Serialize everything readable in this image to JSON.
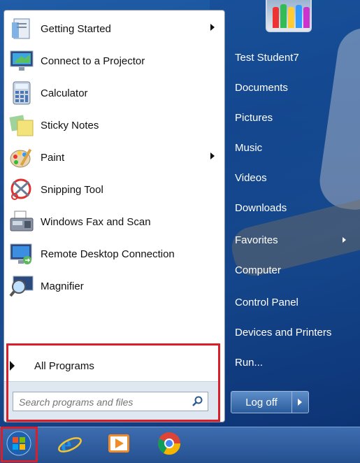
{
  "programs": [
    {
      "label": "Getting Started",
      "icon": "getting-started-icon",
      "has_submenu": true
    },
    {
      "label": "Connect to a Projector",
      "icon": "projector-icon",
      "has_submenu": false
    },
    {
      "label": "Calculator",
      "icon": "calculator-icon",
      "has_submenu": false
    },
    {
      "label": "Sticky Notes",
      "icon": "sticky-notes-icon",
      "has_submenu": false
    },
    {
      "label": "Paint",
      "icon": "paint-icon",
      "has_submenu": true
    },
    {
      "label": "Snipping Tool",
      "icon": "snipping-tool-icon",
      "has_submenu": false
    },
    {
      "label": "Windows Fax and Scan",
      "icon": "fax-scan-icon",
      "has_submenu": false
    },
    {
      "label": "Remote Desktop Connection",
      "icon": "remote-desktop-icon",
      "has_submenu": false
    },
    {
      "label": "Magnifier",
      "icon": "magnifier-icon",
      "has_submenu": false
    }
  ],
  "all_programs": "All Programs",
  "search": {
    "placeholder": "Search programs and files"
  },
  "right_pane": [
    {
      "label": "Test Student7",
      "has_submenu": false
    },
    {
      "label": "Documents",
      "has_submenu": false
    },
    {
      "label": "Pictures",
      "has_submenu": false
    },
    {
      "label": "Music",
      "has_submenu": false
    },
    {
      "label": "Videos",
      "has_submenu": false
    },
    {
      "label": "Downloads",
      "has_submenu": false
    },
    {
      "label": "Favorites",
      "has_submenu": true
    },
    {
      "label": "Computer",
      "has_submenu": false
    },
    {
      "label": "Control Panel",
      "has_submenu": false
    },
    {
      "label": "Devices and Printers",
      "has_submenu": false
    },
    {
      "label": "Run...",
      "has_submenu": false
    }
  ],
  "logoff": "Log off",
  "taskbar": [
    {
      "icon": "start-orb-icon"
    },
    {
      "icon": "internet-explorer-icon"
    },
    {
      "icon": "media-player-icon"
    },
    {
      "icon": "chrome-icon"
    }
  ],
  "colors": {
    "highlight": "#d81f2a",
    "taskbar": "#2d5a9a"
  }
}
